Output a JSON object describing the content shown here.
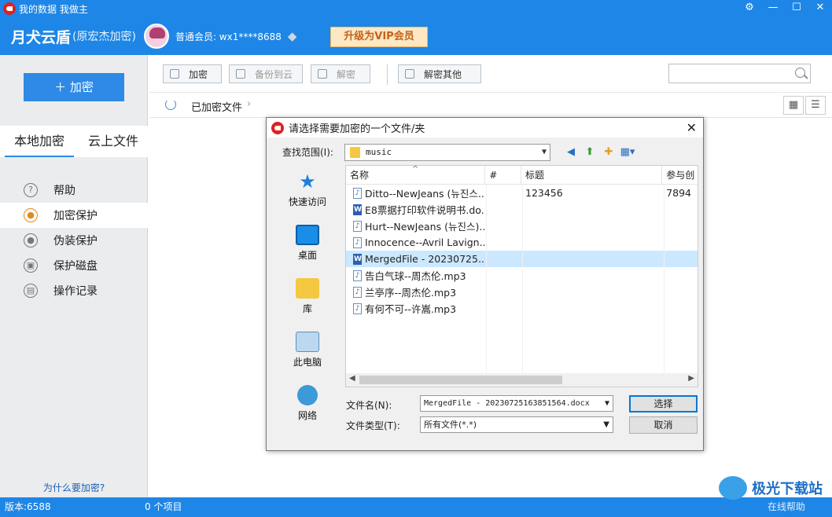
{
  "titlebar": {
    "title": "我的数据 我做主",
    "app_name": "月犬云盾",
    "app_sub": "(原宏杰加密)",
    "member": "普通会员: wx1****8688",
    "vip_button": "升级为VIP会员",
    "buttons": [
      "⚙",
      "—",
      "☐",
      "✕"
    ]
  },
  "sidebar": {
    "encrypt_button": "＋  加密",
    "tabs": [
      "本地加密",
      "云上文件"
    ],
    "items": [
      {
        "label": "帮助",
        "icon": "?"
      },
      {
        "label": "加密保护",
        "icon": "●"
      },
      {
        "label": "伪装保护",
        "icon": "●"
      },
      {
        "label": "保护磁盘",
        "icon": "▣"
      },
      {
        "label": "操作记录",
        "icon": "▤"
      }
    ],
    "why_link": "为什么要加密?"
  },
  "toolbar": {
    "encrypt": "加密",
    "backup": "备份到云",
    "decrypt": "解密",
    "decrypt_other": "解密其他"
  },
  "pathbar": {
    "crumb": "已加密文件"
  },
  "status": {
    "version": "版本:6588",
    "items": "0 个项目",
    "help": "在线帮助"
  },
  "dialog": {
    "title": "请选择需要加密的一个文件/夹",
    "lookin_label": "查找范围(I):",
    "lookin_value": "music",
    "places": [
      "快速访问",
      "桌面",
      "库",
      "此电脑",
      "网络"
    ],
    "columns": [
      "名称",
      "#",
      "标题",
      "参与创"
    ],
    "files": [
      {
        "name": "Ditto--NewJeans (뉴진스...",
        "num": "",
        "title": "123456",
        "artist": "7894",
        "type": "audio"
      },
      {
        "name": "E8票据打印软件说明书.do...",
        "num": "",
        "title": "",
        "artist": "",
        "type": "doc"
      },
      {
        "name": "Hurt--NewJeans (뉴진스)...",
        "num": "",
        "title": "",
        "artist": "",
        "type": "audio"
      },
      {
        "name": "Innocence--Avril Lavign...",
        "num": "",
        "title": "",
        "artist": "",
        "type": "audio"
      },
      {
        "name": "MergedFile - 20230725...",
        "num": "",
        "title": "",
        "artist": "",
        "type": "doc"
      },
      {
        "name": "告白气球--周杰伦.mp3",
        "num": "",
        "title": "",
        "artist": "",
        "type": "audio"
      },
      {
        "name": "兰亭序--周杰伦.mp3",
        "num": "",
        "title": "",
        "artist": "",
        "type": "audio"
      },
      {
        "name": "有何不可--许嵩.mp3",
        "num": "",
        "title": "",
        "artist": "",
        "type": "audio"
      }
    ],
    "selected_index": 4,
    "filename_label": "文件名(N):",
    "filename_value": "MergedFile - 20230725163851564.docx",
    "filetype_label": "文件类型(T):",
    "filetype_value": "所有文件(*.*)",
    "select_button": "选择",
    "cancel_button": "取消"
  },
  "watermark": "极光下载站",
  "colors": {
    "brand": "#1e86e6",
    "vip_bg": "#fde8c3",
    "selected_row": "#cce8ff"
  }
}
